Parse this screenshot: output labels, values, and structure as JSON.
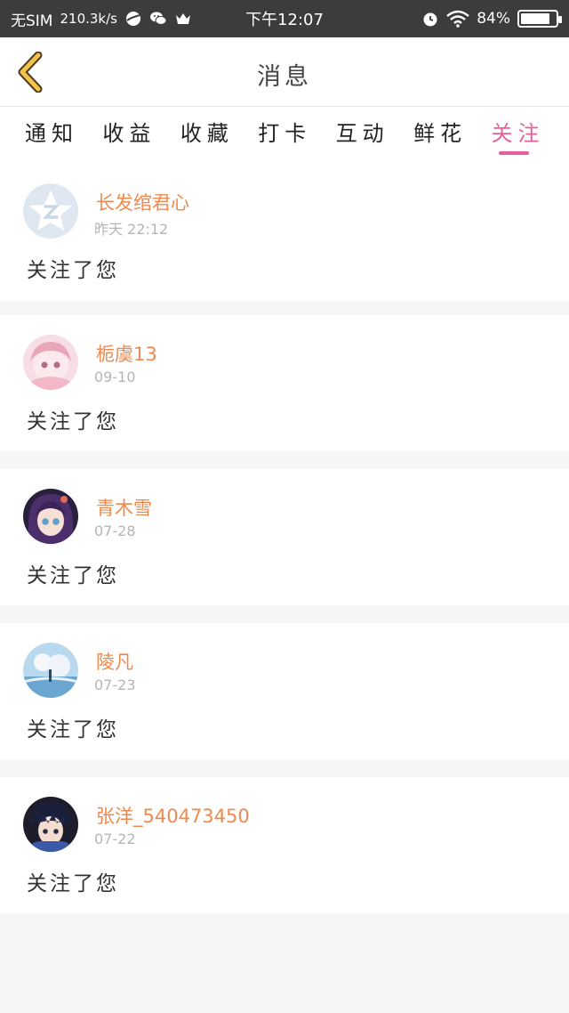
{
  "status_bar": {
    "carrier": "无SIM",
    "net_speed": "210.3k/s",
    "time": "下午12:07",
    "battery_text": "84%",
    "battery_level": 0.84
  },
  "header": {
    "title": "消息"
  },
  "tabs": [
    {
      "label": "通知",
      "active": false
    },
    {
      "label": "收益",
      "active": false
    },
    {
      "label": "收藏",
      "active": false
    },
    {
      "label": "打卡",
      "active": false
    },
    {
      "label": "互动",
      "active": false
    },
    {
      "label": "鲜花",
      "active": false
    },
    {
      "label": "关注",
      "active": true
    }
  ],
  "colors": {
    "accent": "#e55f9c",
    "username": "#ee8a4f",
    "back_arrow": "#f2c24a"
  },
  "items": [
    {
      "name": "长发绾君心",
      "time": "昨天 22:12",
      "message": "关注了您",
      "avatar_icon": "qq-default-avatar-icon"
    },
    {
      "name": "栀虞13",
      "time": "09-10",
      "message": "关注了您",
      "avatar_icon": "anime-girl-avatar-icon"
    },
    {
      "name": "青木雪",
      "time": "07-28",
      "message": "关注了您",
      "avatar_icon": "anime-purple-hair-avatar-icon"
    },
    {
      "name": "陵凡",
      "time": "07-23",
      "message": "关注了您",
      "avatar_icon": "sky-scene-avatar-icon"
    },
    {
      "name": "张洋_540473450",
      "time": "07-22",
      "message": "关注了您",
      "avatar_icon": "anime-boy-avatar-icon"
    }
  ]
}
